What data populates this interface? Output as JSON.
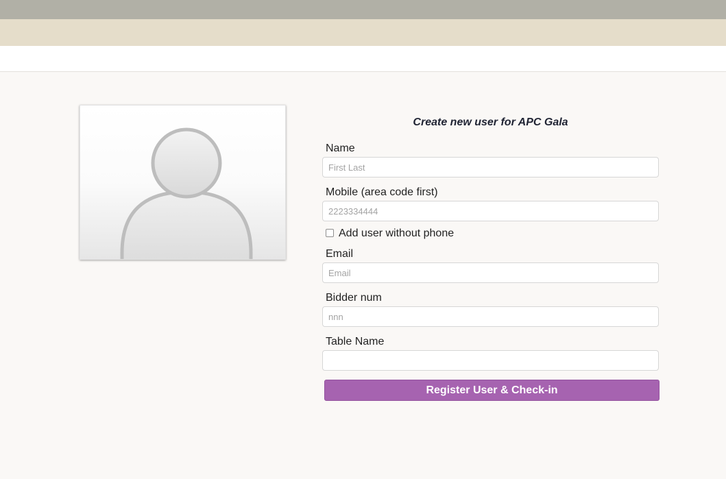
{
  "form": {
    "title": "Create new user for APC Gala",
    "name_label": "Name",
    "name_placeholder": "First Last",
    "mobile_label": "Mobile (area code first)",
    "mobile_placeholder": "2223334444",
    "no_phone_label": "Add user without phone",
    "no_phone_checked": false,
    "email_label": "Email",
    "email_placeholder": "Email",
    "bidder_label": "Bidder num",
    "bidder_placeholder": "nnn",
    "table_label": "Table Name",
    "table_value": "",
    "submit_label": "Register User & Check-in"
  },
  "avatar": {
    "icon": "default-user-avatar-icon"
  },
  "colors": {
    "top_bar": "#b1b0a6",
    "second_bar": "#e5ddca",
    "page_bg": "#faf8f6",
    "button": "#a663b0"
  }
}
